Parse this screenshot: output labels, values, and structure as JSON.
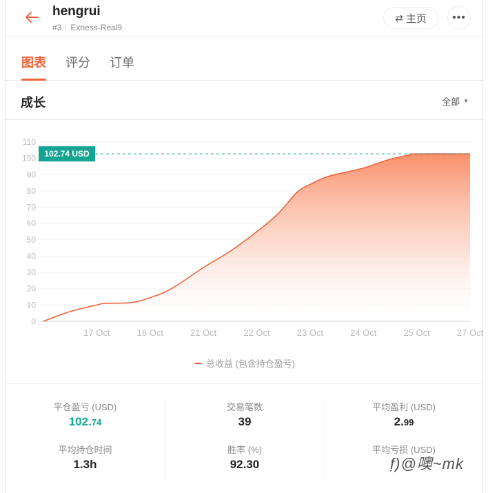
{
  "header": {
    "title": "hengrui",
    "rank": "#3",
    "server": "Exness-Real9",
    "home_label": "主页",
    "home_icon": "swap-icon",
    "more_icon": "more-icon"
  },
  "tabs": [
    {
      "label": "图表",
      "active": true
    },
    {
      "label": "评分",
      "active": false
    },
    {
      "label": "订单",
      "active": false
    }
  ],
  "section": {
    "title": "成长",
    "filter_label": "全部"
  },
  "colors": {
    "accent": "#f0643c",
    "positive": "#13a592",
    "badge_bg": "#13a592"
  },
  "chart_data": {
    "type": "area",
    "title": "成长",
    "xlabel": "",
    "ylabel": "",
    "ylim": [
      0,
      110
    ],
    "yticks": [
      0,
      10,
      20,
      30,
      40,
      50,
      60,
      70,
      80,
      90,
      100,
      110
    ],
    "xticks": [
      "17 Oct",
      "18 Oct",
      "21 Oct",
      "22 Oct",
      "23 Oct",
      "24 Oct",
      "25 Oct",
      "27 Oct"
    ],
    "grid": true,
    "legend_position": "bottom",
    "current_value_label": "102.74 USD",
    "current_value": 102.74,
    "series": [
      {
        "name": "总收益 (包含持仓盈亏)",
        "x": [
          -1,
          -0.5,
          0,
          0.15,
          0.65,
          1,
          1.4,
          2,
          2.5,
          3,
          3.4,
          3.75,
          4,
          4.35,
          5,
          5.45,
          5.85,
          6,
          7
        ],
        "values": [
          0,
          6,
          10,
          11,
          11.5,
          14.5,
          20,
          33,
          43,
          55,
          66,
          79,
          84,
          89,
          94,
          99,
          102,
          102.74,
          102.74
        ]
      }
    ]
  },
  "stats": [
    {
      "label": "平仓盈亏 (USD)",
      "value_int": "102.",
      "value_dec": "74",
      "style": "green"
    },
    {
      "label": "平均持仓时间",
      "value_int": "1.3h",
      "value_dec": "",
      "style": ""
    },
    {
      "label": "交易笔数",
      "value_int": "39",
      "value_dec": "",
      "style": ""
    },
    {
      "label": "胜率 (%)",
      "value_int": "92.30",
      "value_dec": "",
      "style": ""
    },
    {
      "label": "平均盈利 (USD)",
      "value_int": "2.",
      "value_dec": "99",
      "style": ""
    },
    {
      "label": "平均亏损 (USD)",
      "value_int": "",
      "value_dec": "",
      "style": ""
    }
  ],
  "watermark": "f̣)@噢~mk"
}
